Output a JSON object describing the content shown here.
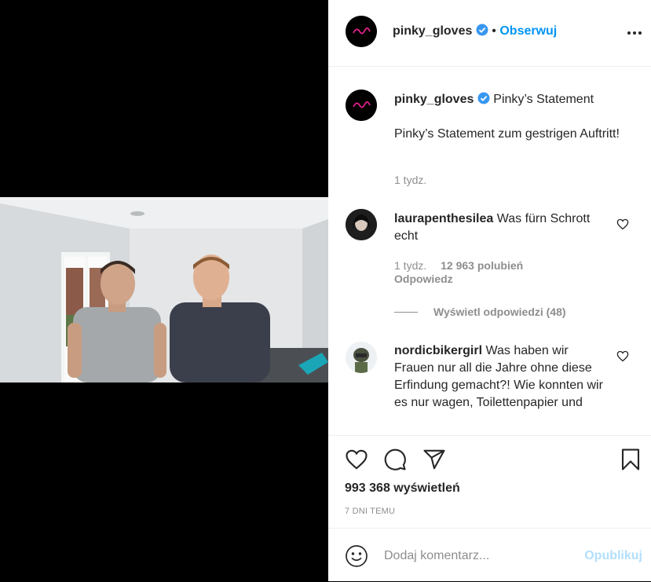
{
  "header": {
    "username": "pinky_gloves",
    "separator": "•",
    "follow_label": "Obserwuj",
    "more_icon": "more-horizontal-icon"
  },
  "caption": {
    "username": "pinky_gloves",
    "title": "Pinky’s Statement",
    "body": "Pinky’s Statement zum gestrigen Auftritt!",
    "time": "1 tydz."
  },
  "comments": [
    {
      "username": "laurapenthesilea",
      "text": "Was fürn Schrott echt",
      "time": "1 tydz.",
      "likes": "12 963 polubień",
      "reply_label": "Odpowiedz",
      "view_replies": "Wyświetl odpowiedzi (48)"
    },
    {
      "username": "nordicbikergirl",
      "text": "Was haben wir Frauen nur all die Jahre ohne diese Erfindung gemacht?! Wie konnten wir es nur wagen, Toilettenpapier und"
    }
  ],
  "actions": {
    "like_icon": "heart-icon",
    "comment_icon": "comment-icon",
    "share_icon": "send-icon",
    "save_icon": "bookmark-icon",
    "views": "993 368 wyświetleń",
    "time_ago": "7 DNI TEMU"
  },
  "add_comment": {
    "emoji_icon": "emoji-icon",
    "placeholder": "Dodaj komentarz...",
    "publish_label": "Opublikuj"
  },
  "colors": {
    "accent": "#0095f6",
    "publish_disabled": "#b2dffc",
    "logo_pink": "#e0218a"
  }
}
